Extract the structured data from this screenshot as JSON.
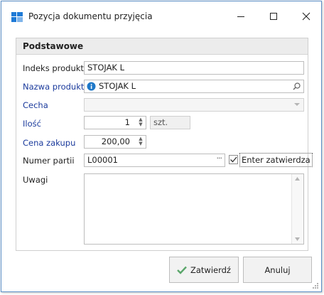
{
  "window": {
    "title": "Pozycja dokumentu przyjęcia",
    "controls": {
      "minimize": "minimize-icon",
      "maximize": "maximize-icon",
      "close": "close-icon"
    }
  },
  "group": {
    "title": "Podstawowe"
  },
  "form": {
    "indeks_label": "Indeks produktu",
    "indeks_value": "STOJAK L",
    "nazwa_label": "Nazwa produktu",
    "nazwa_value": "STOJAK L",
    "cecha_label": "Cecha",
    "cecha_value": "",
    "ilosc_label": "Ilość",
    "ilosc_value": "1",
    "ilosc_unit": "szt.",
    "cena_label": "Cena zakupu",
    "cena_value": "200,00",
    "partia_label": "Numer partii",
    "partia_value": "L00001",
    "enter_label": "Enter zatwierdza",
    "enter_checked": true,
    "uwagi_label": "Uwagi",
    "uwagi_value": ""
  },
  "buttons": {
    "confirm_label": "Zatwierdź",
    "cancel_label": "Anuluj"
  },
  "colors": {
    "accent": "#1e7ad6",
    "required_label": "#1a3a9c",
    "confirm_icon": "#5aa66a",
    "info_icon": "#1e78c8"
  }
}
